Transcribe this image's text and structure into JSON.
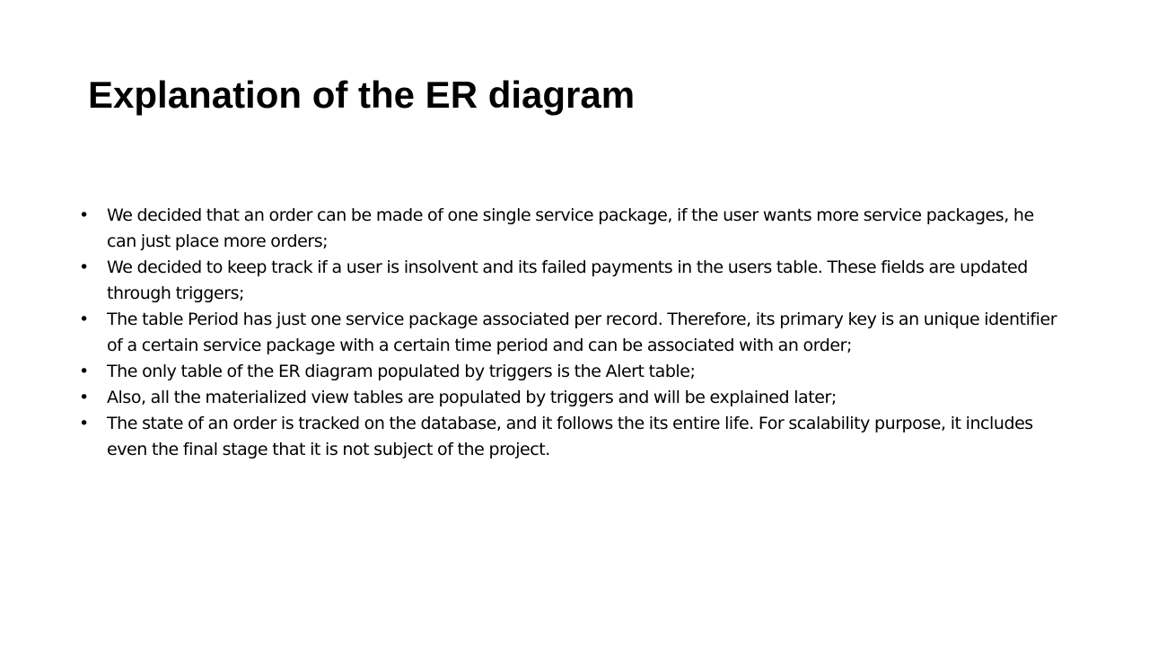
{
  "slide": {
    "title": "Explanation of the ER diagram",
    "bullet_glyph": "•",
    "bullets": [
      "We decided that an order can be made of one single service package, if the user wants more service packages, he can just place more orders;",
      "We decided to keep track if a user is insolvent and its failed payments in the users table. These fields are updated through triggers;",
      "The table Period has just one service package associated per record. Therefore, its primary key is an unique identifier of a certain service package with a certain time period and can be associated with an order;",
      "The only table of the ER diagram populated by triggers is the Alert table;",
      "Also, all the materialized view tables are populated by triggers and will be explained later;",
      "The state of an order is tracked on the database, and it follows the its entire life. For scalability purpose, it includes even the final stage that it is not subject of the project."
    ]
  }
}
